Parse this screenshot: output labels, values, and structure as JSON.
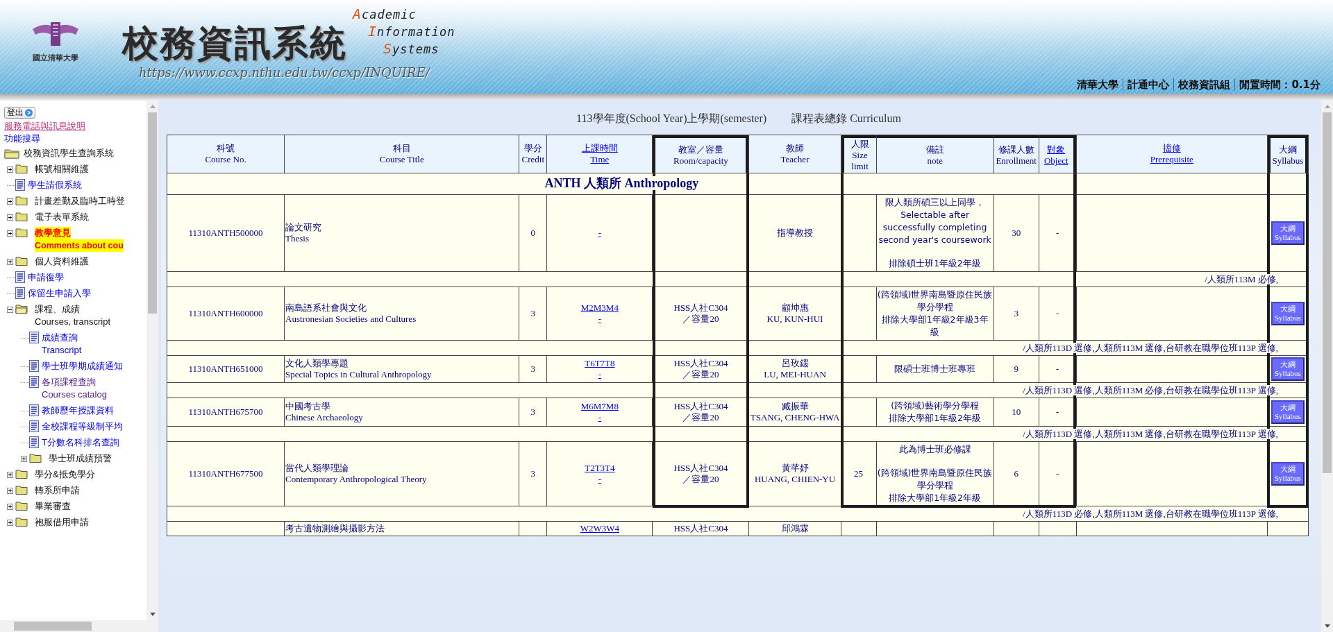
{
  "header": {
    "logo_text": "國立清華大學",
    "title": "校務資訊系統",
    "subtitle": [
      {
        "initial": "A",
        "rest": "cademic"
      },
      {
        "initial": "I",
        "rest": "nformation"
      },
      {
        "initial": "S",
        "rest": "ystems"
      }
    ],
    "url": "https://www.ccxp.nthu.edu.tw/ccxp/INQUIRE/",
    "links": [
      "清華大學",
      "計通中心",
      "校務資訊組",
      "閒置時間：0.1分"
    ]
  },
  "sidebar": {
    "logout": "登出",
    "service_link": "服務電話與訊息說明",
    "search_link": "功能搜尋",
    "tree": [
      {
        "kind": "root",
        "label": "校務資訊學生查詢系統",
        "children": [
          {
            "kind": "folder",
            "label": "帳號相關維護",
            "expanded": false,
            "highlight": false
          },
          {
            "kind": "page",
            "label": "學生請假系統",
            "visited": false
          },
          {
            "kind": "folder",
            "label": "計畫差勤及臨時工時登",
            "expanded": false,
            "highlight": false
          },
          {
            "kind": "folder",
            "label": "電子表單系統",
            "expanded": false,
            "highlight": false
          },
          {
            "kind": "folder",
            "label": "教學意見",
            "label_en": "Comments about cou",
            "expanded": false,
            "highlight": true
          },
          {
            "kind": "folder",
            "label": "個人資料維護",
            "expanded": false,
            "highlight": false
          },
          {
            "kind": "page",
            "label": "申請復學",
            "visited": false
          },
          {
            "kind": "page",
            "label": "保留生申請入學",
            "visited": false
          },
          {
            "kind": "folder",
            "label": "課程、成績",
            "label_en": "Courses, transcript",
            "expanded": true,
            "highlight": false,
            "children": [
              {
                "kind": "page",
                "label": "成績查詢",
                "label_en": "Transcript",
                "visited": false
              },
              {
                "kind": "page",
                "label": "學士班學期成績通知",
                "visited": false
              },
              {
                "kind": "page",
                "label": "各項課程查詢",
                "label_en": "Courses catalog",
                "visited": true
              },
              {
                "kind": "page",
                "label": "教師歷年授課資料",
                "visited": false
              },
              {
                "kind": "page",
                "label": "全校課程等級制平均",
                "visited": false
              },
              {
                "kind": "page",
                "label": "T分數名科排名查詢",
                "visited": false
              },
              {
                "kind": "folder",
                "label": "學士班成績預警",
                "expanded": false,
                "highlight": false
              }
            ]
          },
          {
            "kind": "folder",
            "label": "學分&抵免學分",
            "expanded": false,
            "highlight": false
          },
          {
            "kind": "folder",
            "label": "轉系所申請",
            "expanded": false,
            "highlight": false
          },
          {
            "kind": "folder",
            "label": "畢業審查",
            "expanded": false,
            "highlight": false
          },
          {
            "kind": "folder",
            "label": "袍服借用申請",
            "expanded": false,
            "highlight": false
          }
        ]
      }
    ]
  },
  "page_title": [
    "113學年度(School Year)上學期(semester)",
    "課程表總錄 Curriculum"
  ],
  "table": {
    "columns": [
      {
        "zh": "科號",
        "en": "Course No.",
        "link": false,
        "framed": false
      },
      {
        "zh": "科目",
        "en": "Course Title",
        "link": false,
        "framed": false
      },
      {
        "zh": "學分",
        "en": "Credit",
        "link": false,
        "framed": false
      },
      {
        "zh": "上課時間",
        "en": "Time",
        "link": true,
        "framed": false
      },
      {
        "zh": "教室／容量",
        "en": "Room/capacity",
        "link": false,
        "framed": true
      },
      {
        "zh": "教師",
        "en": "Teacher",
        "link": false,
        "framed": false
      },
      {
        "zh": "人限",
        "en": "Size limit",
        "link": false,
        "framed": true
      },
      {
        "zh": "備註",
        "en": "note",
        "link": false,
        "framed": true
      },
      {
        "zh": "修課人數",
        "en": "Enrollment",
        "link": false,
        "framed": true
      },
      {
        "zh": "對象",
        "en": "Object",
        "link": true,
        "framed": true
      },
      {
        "zh": "擋修",
        "en": "Prerequisite",
        "link": true,
        "framed": false
      },
      {
        "zh": "大綱",
        "en": "Syllabus",
        "link": false,
        "framed": true
      }
    ],
    "department": "ANTH 人類所 Anthropology",
    "courses": [
      {
        "course_no": "11310ANTH500000",
        "title_zh": "論文研究",
        "title_en": "Thesis",
        "credit": "0",
        "time_note": "-",
        "teacher_zh": "指導教授",
        "note": [
          [
            "限人類所碩三以上同學，Selectable after successfully completing second year's coursework"
          ],
          [
            "排除碩士班1年級2年級"
          ]
        ],
        "enrollment": "30",
        "object": "-",
        "syllabus": [
          "大綱",
          "Syllabus"
        ],
        "footer": "/人類所113M 必修,"
      },
      {
        "course_no": "11310ANTH600000",
        "title_zh": "南島語系社會與文化",
        "title_en": "Austronesian Societies and Cultures",
        "credit": "3",
        "time": "M2M3M4",
        "time_note": "-",
        "room": [
          "HSS人社C304",
          "／容量20"
        ],
        "teacher_zh": "顧坤惠",
        "teacher_en": "KU, KUN-HUI",
        "note": [
          [
            "(跨領域)世界南島暨原住民族學分學程",
            "排除大學部1年級2年級3年級"
          ]
        ],
        "enrollment": "3",
        "object": "-",
        "syllabus": [
          "大綱",
          "Syllabus"
        ],
        "footer": "/人類所113D 選修,人類所113M 選修,台研教在職學位班113P 選修,"
      },
      {
        "course_no": "11310ANTH651000",
        "title_zh": "文化人類學專題",
        "title_en": "Special Topics in Cultural Anthropology",
        "credit": "3",
        "time": "T6T7T8",
        "time_note": "-",
        "room": [
          "HSS人社C304",
          "／容量20"
        ],
        "teacher_zh": "呂玫鍰",
        "teacher_en": "LU, MEI-HUAN",
        "note": [
          [
            "限碩士班博士班專班"
          ]
        ],
        "enrollment": "9",
        "object": "-",
        "syllabus": [
          "大綱",
          "Syllabus"
        ],
        "footer": "/人類所113D 選修,人類所113M 必修,台研教在職學位班113P 選修,"
      },
      {
        "course_no": "11310ANTH675700",
        "title_zh": "中國考古學",
        "title_en": "Chinese Archaeology",
        "credit": "3",
        "time": "M6M7M8",
        "time_note": "-",
        "room": [
          "HSS人社C304",
          "／容量20"
        ],
        "teacher_zh": "臧振華",
        "teacher_en": "TSANG, CHENG-HWA",
        "note": [
          [
            "(跨領域)藝術學分學程",
            "排除大學部1年級2年級"
          ]
        ],
        "enrollment": "10",
        "object": "-",
        "syllabus": [
          "大綱",
          "Syllabus"
        ],
        "footer": "/人類所113D 選修,人類所113M 選修,台研教在職學位班113P 選修,"
      },
      {
        "course_no": "11310ANTH677500",
        "title_zh": "當代人類學理論",
        "title_en": "Contemporary Anthropological Theory",
        "credit": "3",
        "time": "T2T3T4",
        "time_note": "-",
        "room": [
          "HSS人社C304",
          "／容量20"
        ],
        "teacher_zh": "黃芊妤",
        "teacher_en": "HUANG, CHIEN-YU",
        "size_limit": "25",
        "note": [
          [
            "此為博士班必修課"
          ],
          [
            "(跨領域)世界南島暨原住民族學分學程",
            "排除大學部1年級2年級"
          ]
        ],
        "enrollment": "6",
        "object": "-",
        "syllabus": [
          "大綱",
          "Syllabus"
        ],
        "footer": "/人類所113D 必修,人類所113M 選修,台研教在職學位班113P 選修,"
      },
      {
        "title_zh": "考古遺物測繪與攝影方法",
        "time": "W2W3W4",
        "room": [
          "HSS人社C304"
        ],
        "teacher_zh": "邱鴻霖"
      }
    ]
  }
}
